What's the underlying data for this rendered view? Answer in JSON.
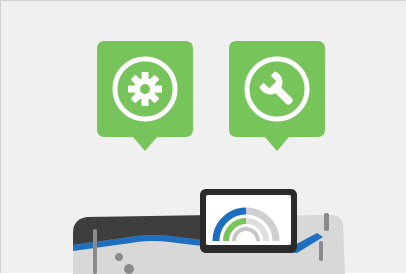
{
  "scene": {
    "background_color": "#f0f0f0",
    "accent_color": "#76c45a",
    "pins": [
      {
        "name": "settings",
        "icon": "gear-icon",
        "color": "#76c45a"
      },
      {
        "name": "service",
        "icon": "wrench-icon",
        "color": "#76c45a"
      }
    ],
    "device": {
      "body_color": "#d8d8d8",
      "top_color": "#3e3e3e",
      "stripe_color": "#1f6fc0",
      "screen": {
        "frame_color": "#2b2b2b",
        "arc_colors": [
          "#1f6fc0",
          "#76c45a",
          "#b8b8b8"
        ]
      }
    }
  }
}
